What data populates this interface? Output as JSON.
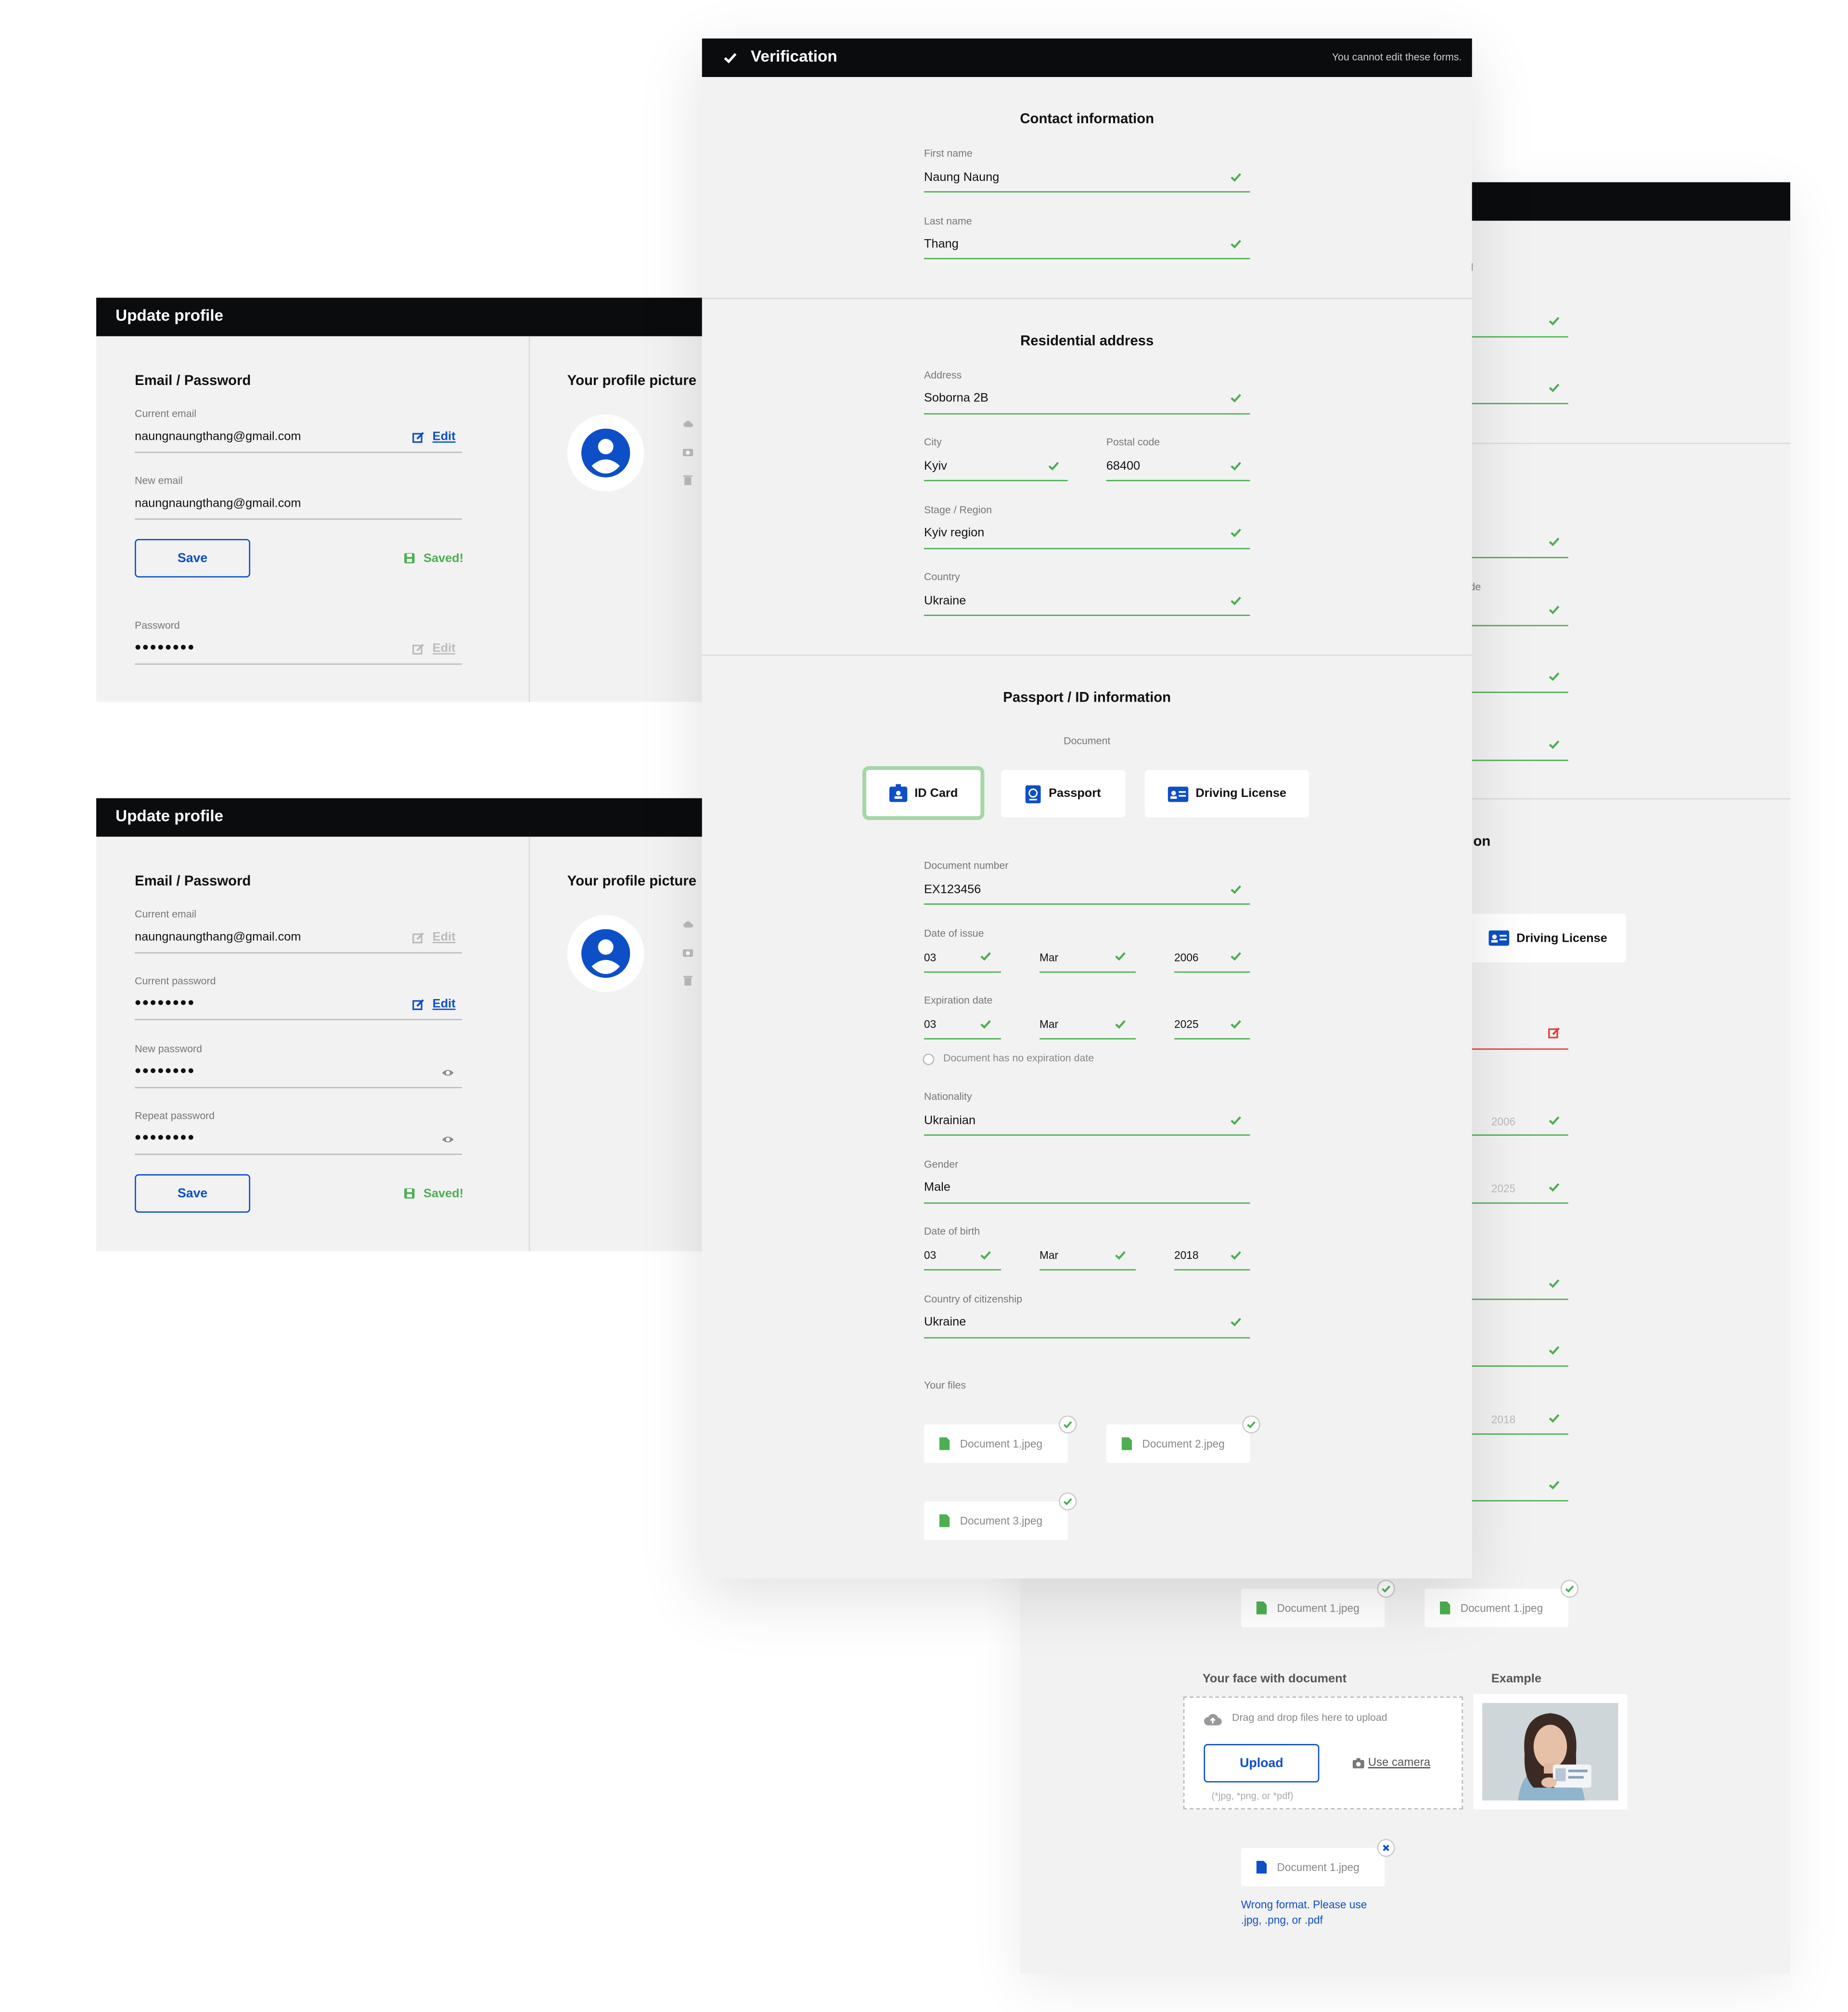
{
  "profile_panels": [
    {
      "title": "Update profile",
      "section_title": "Email / Password",
      "picture_title": "Your profile picture",
      "current_email_label": "Current email",
      "current_email": "naungnaungthang@gmail.com",
      "edit_label": "Edit",
      "new_email_label": "New email",
      "new_email": "naungnaungthang@gmail.com",
      "save_label": "Save",
      "saved_label": "Saved!",
      "password_label": "Password",
      "password_value": "••••••••",
      "password_edit_label": "Edit"
    },
    {
      "title": "Update profile",
      "section_title": "Email / Password",
      "picture_title": "Your profile picture",
      "current_email_label": "Current email",
      "current_email": "naungnaungthang@gmail.com",
      "email_edit_label": "Edit",
      "current_password_label": "Current password",
      "current_password": "••••••••",
      "password_edit_label": "Edit",
      "new_password_label": "New password",
      "new_password": "••••••••",
      "repeat_password_label": "Repeat password",
      "repeat_password": "••••••••",
      "save_label": "Save",
      "saved_label": "Saved!"
    }
  ],
  "verification": {
    "title": "Verification",
    "notice": "You cannot edit these forms.",
    "contact": {
      "title": "Contact information",
      "first_name_label": "First name",
      "first_name": "Naung Naung",
      "last_name_label": "Last name",
      "last_name": "Thang"
    },
    "address": {
      "title": "Residential address",
      "address_label": "Address",
      "address": "Soborna 2B",
      "city_label": "City",
      "city": "Kyiv",
      "postal_label": "Postal code",
      "postal": "68400",
      "region_label": "Stage / Region",
      "region": "Kyiv region",
      "country_label": "Country",
      "country": "Ukraine"
    },
    "passport": {
      "title": "Passport / ID information",
      "document_label": "Document",
      "doc_types": [
        "ID Card",
        "Passport",
        "Driving License"
      ],
      "selected_doc": "ID Card",
      "doc_number_label": "Document number",
      "doc_number": "EX123456",
      "issue_label": "Date of issue",
      "issue_day": "03",
      "issue_month": "Mar",
      "issue_year": "2006",
      "expiration_label": "Expiration date",
      "exp_day": "03",
      "exp_month": "Mar",
      "exp_year": "2025",
      "no_expiration_label": "Document has no expiration date",
      "nationality_label": "Nationality",
      "nationality": "Ukrainian",
      "gender_label": "Gender",
      "gender": "Male",
      "dob_label": "Date of birth",
      "dob_day": "03",
      "dob_month": "Mar",
      "dob_year": "2018",
      "citizenship_label": "Country of citizenship",
      "citizenship": "Ukraine",
      "files_label": "Your files",
      "files": [
        "Document 1.jpeg",
        "Document 2.jpeg",
        "Document 3.jpeg"
      ]
    }
  },
  "back_panel": {
    "section_fragment": "on",
    "postal_fragment": "de",
    "driving_license_label": "Driving License",
    "issue_year": "2006",
    "exp_year": "2025",
    "dob_year": "2018",
    "files": [
      "Document 1.jpeg",
      "Document 1.jpeg"
    ],
    "face_title": "Your face with document",
    "example_title": "Example",
    "drop_text": "Drag and drop files here to upload",
    "upload_label": "Upload",
    "camera_label": "Use camera",
    "formats_hint": "(*jpg, *png, or *pdf)",
    "error_file": "Document 1.jpeg",
    "error_text": "Wrong format. Please use .jpg, .png, or .pdf"
  },
  "colors": {
    "accent_blue": "#0d4fc7",
    "success_green": "#4caf50",
    "error_red": "#e53935",
    "header_black": "#0b0c0e",
    "panel_gray": "#f2f2f2"
  }
}
